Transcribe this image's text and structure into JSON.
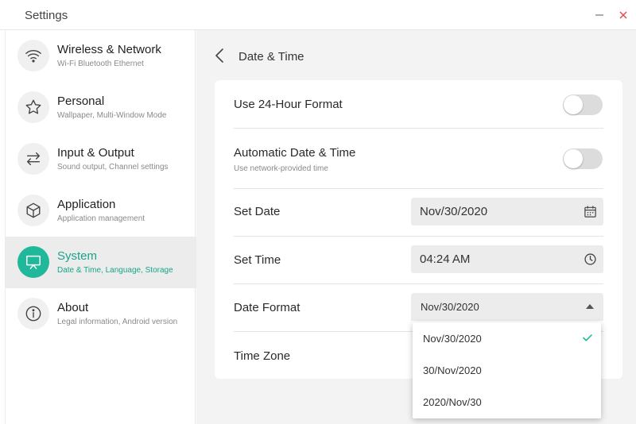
{
  "window": {
    "title": "Settings",
    "minimize_icon": "minus-icon",
    "close_icon": "close-icon",
    "close_color": "#e04a4a"
  },
  "sidebar": {
    "accent_color": "#1fb89a",
    "items": [
      {
        "title": "Wireless & Network",
        "subtitle": "Wi-Fi Bluetooth Ethernet",
        "icon": "wifi-icon",
        "active": false
      },
      {
        "title": "Personal",
        "subtitle": "Wallpaper, Multi-Window Mode",
        "icon": "star-icon",
        "active": false
      },
      {
        "title": "Input & Output",
        "subtitle": "Sound output, Channel settings",
        "icon": "swap-arrows-icon",
        "active": false
      },
      {
        "title": "Application",
        "subtitle": "Application management",
        "icon": "cube-icon",
        "active": false
      },
      {
        "title": "System",
        "subtitle": "Date & Time, Language, Storage",
        "icon": "monitor-icon",
        "active": true
      },
      {
        "title": "About",
        "subtitle": "Legal information, Android version",
        "icon": "info-icon",
        "active": false
      }
    ]
  },
  "page": {
    "title": "Date & Time",
    "back_icon": "chevron-left-icon",
    "rows": {
      "format24": {
        "label": "Use 24-Hour Format",
        "enabled": false
      },
      "auto_time": {
        "label": "Automatic Date & Time",
        "subtitle": "Use network-provided time",
        "enabled": false
      },
      "set_date": {
        "label": "Set Date",
        "value": "Nov/30/2020",
        "icon": "calendar-icon"
      },
      "set_time": {
        "label": "Set Time",
        "value": "04:24 AM",
        "icon": "clock-icon"
      },
      "date_format": {
        "label": "Date Format",
        "value": "Nov/30/2020",
        "icon": "caret-up-icon"
      },
      "time_zone": {
        "label": "Time Zone"
      }
    }
  },
  "dropdown": {
    "options": [
      "Nov/30/2020",
      "30/Nov/2020",
      "2020/Nov/30"
    ],
    "selected": "Nov/30/2020",
    "check_icon": "check-icon"
  }
}
